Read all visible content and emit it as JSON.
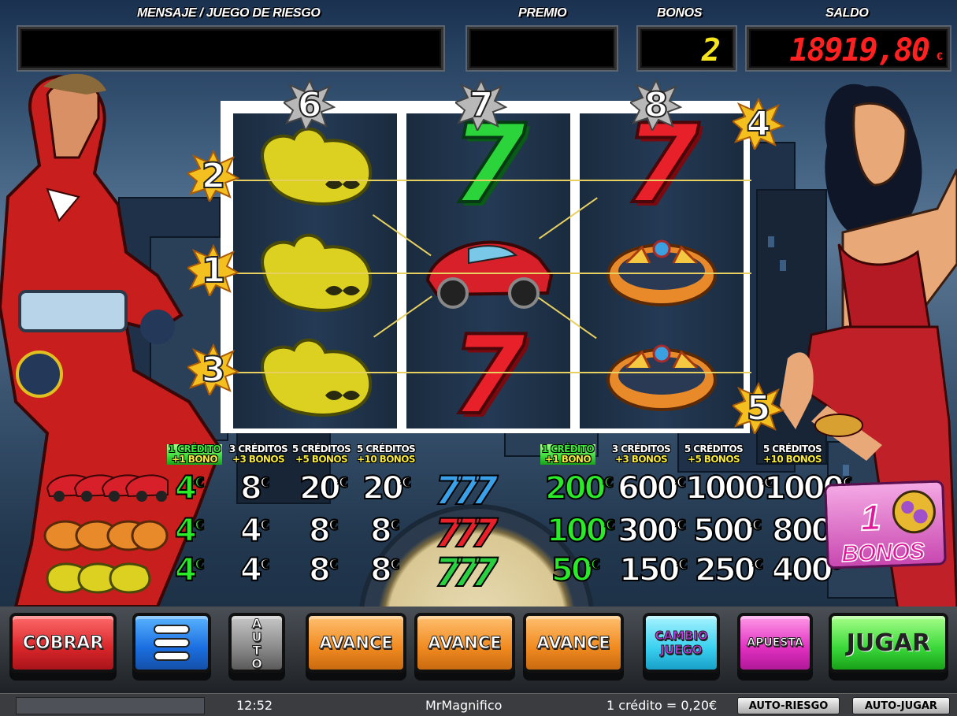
{
  "header": {
    "message_label": "MENSAJE / JUEGO DE RIESGO",
    "message_value": "",
    "prize_label": "PREMIO",
    "prize_value": "",
    "bonus_label": "BONOS",
    "bonus_value": "2",
    "balance_label": "SALDO",
    "balance_value": "18919,80",
    "balance_unit": "€"
  },
  "reels": {
    "symbols": [
      [
        "money-bag",
        "money-bag",
        "money-bag"
      ],
      [
        "green-seven",
        "red-car",
        "red-seven"
      ],
      [
        "red-seven",
        "ring",
        "ring"
      ]
    ],
    "seven_glyph": "7",
    "reel_numbers": [
      "6",
      "7",
      "8"
    ],
    "line_numbers_left": [
      "2",
      "1",
      "3"
    ],
    "line_numbers_right": [
      "4",
      "5"
    ]
  },
  "paytable_left": {
    "headers": [
      {
        "credits": "1 CRÉDITO",
        "bonos": "+1 BONO"
      },
      {
        "credits": "3 CRÉDITOS",
        "bonos": "+3 BONOS"
      },
      {
        "credits": "5 CRÉDITOS",
        "bonos": "+5 BONOS"
      },
      {
        "credits": "5 CRÉDITOS",
        "bonos": "+10 BONOS"
      }
    ],
    "rows": [
      {
        "symbol": "car",
        "values": [
          "4",
          "8",
          "20",
          "20"
        ]
      },
      {
        "symbol": "ring",
        "values": [
          "4",
          "4",
          "8",
          "8"
        ]
      },
      {
        "symbol": "money-bag",
        "values": [
          "4",
          "4",
          "8",
          "8"
        ]
      }
    ]
  },
  "paytable_right": {
    "headers": [
      {
        "credits": "1 CRÉDITO",
        "bonos": "+1 BONO"
      },
      {
        "credits": "3 CRÉDITOS",
        "bonos": "+3 BONOS"
      },
      {
        "credits": "5 CRÉDITOS",
        "bonos": "+5 BONOS"
      },
      {
        "credits": "5 CRÉDITOS",
        "bonos": "+10 BONOS"
      }
    ],
    "rows": [
      {
        "symbol": "blue-777",
        "values": [
          "200",
          "600",
          "1000",
          "1000"
        ]
      },
      {
        "symbol": "red-777",
        "values": [
          "100",
          "300",
          "500",
          "800"
        ]
      },
      {
        "symbol": "green-777",
        "values": [
          "50",
          "150",
          "250",
          "400"
        ]
      }
    ],
    "seven_group": "777"
  },
  "currency": "€",
  "bonus_box": {
    "count": "1",
    "label": "BONOS"
  },
  "buttons": {
    "cobrar": "COBRAR",
    "auto": "AUTO",
    "avance": "AVANCE",
    "cambio_juego": "CAMBIO JUEGO",
    "apuesta": "APUESTA",
    "jugar": "JUGAR"
  },
  "status": {
    "time": "12:52",
    "user": "MrMagnifico",
    "credit_value": "1 crédito = 0,20€",
    "auto_riesgo": "AUTO-RIESGO",
    "auto_jugar": "AUTO-JUGAR"
  },
  "colors": {
    "bonus_digits": "#f6e41c",
    "balance_digits": "#ff2020",
    "accent_green": "#2aea2a"
  }
}
